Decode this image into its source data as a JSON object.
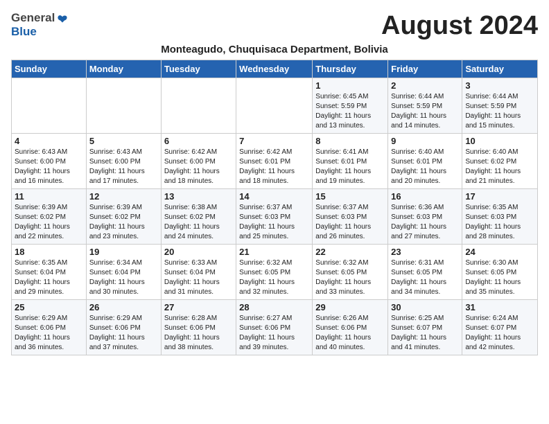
{
  "header": {
    "logo_general": "General",
    "logo_blue": "Blue",
    "month_year": "August 2024",
    "subtitle": "Monteagudo, Chuquisaca Department, Bolivia"
  },
  "weekdays": [
    "Sunday",
    "Monday",
    "Tuesday",
    "Wednesday",
    "Thursday",
    "Friday",
    "Saturday"
  ],
  "weeks": [
    [
      {
        "day": "",
        "info": ""
      },
      {
        "day": "",
        "info": ""
      },
      {
        "day": "",
        "info": ""
      },
      {
        "day": "",
        "info": ""
      },
      {
        "day": "1",
        "info": "Sunrise: 6:45 AM\nSunset: 5:59 PM\nDaylight: 11 hours\nand 13 minutes."
      },
      {
        "day": "2",
        "info": "Sunrise: 6:44 AM\nSunset: 5:59 PM\nDaylight: 11 hours\nand 14 minutes."
      },
      {
        "day": "3",
        "info": "Sunrise: 6:44 AM\nSunset: 5:59 PM\nDaylight: 11 hours\nand 15 minutes."
      }
    ],
    [
      {
        "day": "4",
        "info": "Sunrise: 6:43 AM\nSunset: 6:00 PM\nDaylight: 11 hours\nand 16 minutes."
      },
      {
        "day": "5",
        "info": "Sunrise: 6:43 AM\nSunset: 6:00 PM\nDaylight: 11 hours\nand 17 minutes."
      },
      {
        "day": "6",
        "info": "Sunrise: 6:42 AM\nSunset: 6:00 PM\nDaylight: 11 hours\nand 18 minutes."
      },
      {
        "day": "7",
        "info": "Sunrise: 6:42 AM\nSunset: 6:01 PM\nDaylight: 11 hours\nand 18 minutes."
      },
      {
        "day": "8",
        "info": "Sunrise: 6:41 AM\nSunset: 6:01 PM\nDaylight: 11 hours\nand 19 minutes."
      },
      {
        "day": "9",
        "info": "Sunrise: 6:40 AM\nSunset: 6:01 PM\nDaylight: 11 hours\nand 20 minutes."
      },
      {
        "day": "10",
        "info": "Sunrise: 6:40 AM\nSunset: 6:02 PM\nDaylight: 11 hours\nand 21 minutes."
      }
    ],
    [
      {
        "day": "11",
        "info": "Sunrise: 6:39 AM\nSunset: 6:02 PM\nDaylight: 11 hours\nand 22 minutes."
      },
      {
        "day": "12",
        "info": "Sunrise: 6:39 AM\nSunset: 6:02 PM\nDaylight: 11 hours\nand 23 minutes."
      },
      {
        "day": "13",
        "info": "Sunrise: 6:38 AM\nSunset: 6:02 PM\nDaylight: 11 hours\nand 24 minutes."
      },
      {
        "day": "14",
        "info": "Sunrise: 6:37 AM\nSunset: 6:03 PM\nDaylight: 11 hours\nand 25 minutes."
      },
      {
        "day": "15",
        "info": "Sunrise: 6:37 AM\nSunset: 6:03 PM\nDaylight: 11 hours\nand 26 minutes."
      },
      {
        "day": "16",
        "info": "Sunrise: 6:36 AM\nSunset: 6:03 PM\nDaylight: 11 hours\nand 27 minutes."
      },
      {
        "day": "17",
        "info": "Sunrise: 6:35 AM\nSunset: 6:03 PM\nDaylight: 11 hours\nand 28 minutes."
      }
    ],
    [
      {
        "day": "18",
        "info": "Sunrise: 6:35 AM\nSunset: 6:04 PM\nDaylight: 11 hours\nand 29 minutes."
      },
      {
        "day": "19",
        "info": "Sunrise: 6:34 AM\nSunset: 6:04 PM\nDaylight: 11 hours\nand 30 minutes."
      },
      {
        "day": "20",
        "info": "Sunrise: 6:33 AM\nSunset: 6:04 PM\nDaylight: 11 hours\nand 31 minutes."
      },
      {
        "day": "21",
        "info": "Sunrise: 6:32 AM\nSunset: 6:05 PM\nDaylight: 11 hours\nand 32 minutes."
      },
      {
        "day": "22",
        "info": "Sunrise: 6:32 AM\nSunset: 6:05 PM\nDaylight: 11 hours\nand 33 minutes."
      },
      {
        "day": "23",
        "info": "Sunrise: 6:31 AM\nSunset: 6:05 PM\nDaylight: 11 hours\nand 34 minutes."
      },
      {
        "day": "24",
        "info": "Sunrise: 6:30 AM\nSunset: 6:05 PM\nDaylight: 11 hours\nand 35 minutes."
      }
    ],
    [
      {
        "day": "25",
        "info": "Sunrise: 6:29 AM\nSunset: 6:06 PM\nDaylight: 11 hours\nand 36 minutes."
      },
      {
        "day": "26",
        "info": "Sunrise: 6:29 AM\nSunset: 6:06 PM\nDaylight: 11 hours\nand 37 minutes."
      },
      {
        "day": "27",
        "info": "Sunrise: 6:28 AM\nSunset: 6:06 PM\nDaylight: 11 hours\nand 38 minutes."
      },
      {
        "day": "28",
        "info": "Sunrise: 6:27 AM\nSunset: 6:06 PM\nDaylight: 11 hours\nand 39 minutes."
      },
      {
        "day": "29",
        "info": "Sunrise: 6:26 AM\nSunset: 6:06 PM\nDaylight: 11 hours\nand 40 minutes."
      },
      {
        "day": "30",
        "info": "Sunrise: 6:25 AM\nSunset: 6:07 PM\nDaylight: 11 hours\nand 41 minutes."
      },
      {
        "day": "31",
        "info": "Sunrise: 6:24 AM\nSunset: 6:07 PM\nDaylight: 11 hours\nand 42 minutes."
      }
    ]
  ]
}
